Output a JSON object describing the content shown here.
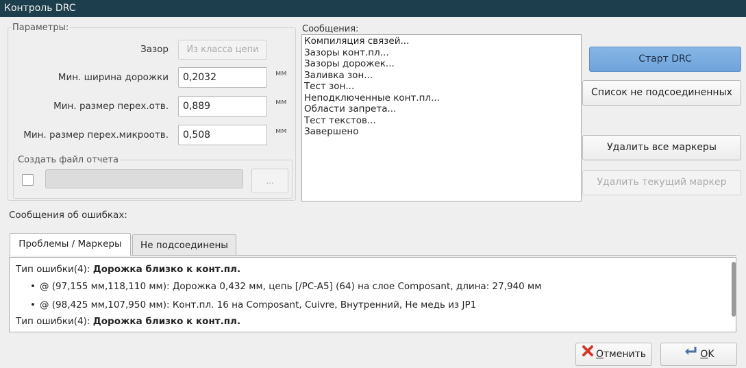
{
  "window": {
    "title": "Контроль DRC"
  },
  "params": {
    "title": "Параметры:",
    "clearance_label": "Зазор",
    "clearance_value": "Из класса цепи",
    "rows": [
      {
        "label": "Мин. ширина дорожки",
        "value": "0,2032",
        "unit": "мм"
      },
      {
        "label": "Мин. размер перех.отв.",
        "value": "0,889",
        "unit": "мм"
      },
      {
        "label": "Мин. размер перех.микроотв.",
        "value": "0,508",
        "unit": "мм"
      }
    ],
    "report": {
      "title": "Создать файл отчета",
      "checked": false,
      "path": "",
      "browse_label": "..."
    }
  },
  "messages": {
    "title": "Сообщения:",
    "lines": [
      "Компиляция связей...",
      "Зазоры конт.пл...",
      "Зазоры дорожек...",
      "Заливка зон...",
      "Тест зон...",
      "Неподключенные конт.пл...",
      "Области запрета...",
      "Тест текстов...",
      "Завершено"
    ]
  },
  "actions": {
    "start": "Старт DRC",
    "unconnected": "Список не подсоединенных",
    "delete_all": "Удалить все маркеры",
    "delete_current": "Удалить текущий маркер"
  },
  "errors": {
    "title": "Сообщения об ошибках:",
    "tabs": [
      {
        "label": "Проблемы / Маркеры",
        "active": true
      },
      {
        "label": "Не подсоединены",
        "active": false
      }
    ],
    "items": [
      {
        "prefix": "Тип ошибки(4): ",
        "type": "Дорожка близко к конт.пл.",
        "details": [
          "@ (97,155 мм,118,110 мм): Дорожка 0,432 мм, цепь [/PC-A5] (64) на слое Composant, длина: 27,940 мм",
          "@ (98,425 мм,107,950 мм): Конт.пл. 16 на Composant, Cuivre, Внутренний, Не медь из JP1"
        ]
      },
      {
        "prefix": "Тип ошибки(4): ",
        "type": "Дорожка близко к конт.пл.",
        "details": []
      }
    ]
  },
  "footer": {
    "cancel_prefix": "О",
    "cancel_rest": "тменить",
    "ok_prefix": "O",
    "ok_rest": "K"
  }
}
